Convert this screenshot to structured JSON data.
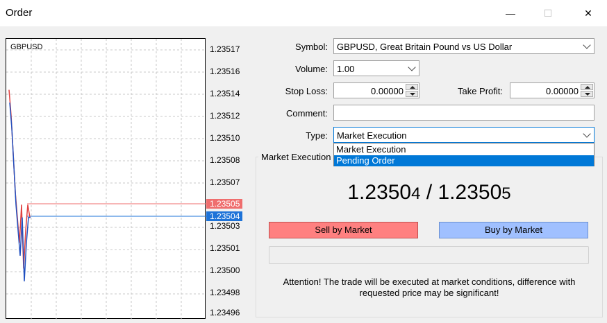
{
  "window": {
    "title": "Order",
    "minimize_glyph": "—",
    "maximize_glyph": "☐",
    "close_glyph": "✕"
  },
  "chart": {
    "symbol": "GBPUSD",
    "ask_price": "1.23505",
    "bid_price": "1.23504",
    "ask_color": "#ef6e6e",
    "bid_color": "#1e73d8",
    "ticks": [
      "1.23517",
      "1.23516",
      "1.23514",
      "1.23512",
      "1.23510",
      "1.23508",
      "1.23507",
      "1.23503",
      "1.23501",
      "1.23500",
      "1.23498",
      "1.23496"
    ]
  },
  "chart_data": {
    "type": "line",
    "title": "GBPUSD",
    "xlabel": "",
    "ylabel": "",
    "ylim": [
      1.23496,
      1.23518
    ],
    "grid": true,
    "series": [
      {
        "values": [
          1.23514,
          1.23512,
          1.23509,
          1.23506,
          1.23504,
          1.23502,
          1.23505,
          1.235,
          1.23503,
          1.23505,
          1.23504
        ]
      },
      {
        "values": [
          1.23513,
          1.23511,
          1.23508,
          1.23505,
          1.23503,
          1.23501,
          1.23504,
          1.23499,
          1.23502,
          1.23504,
          1.23504
        ]
      }
    ]
  },
  "form": {
    "symbol_label": "Symbol:",
    "symbol_value": "GBPUSD, Great Britain Pound vs US Dollar",
    "volume_label": "Volume:",
    "volume_value": "1.00",
    "stoploss_label": "Stop Loss:",
    "stoploss_value": "0.00000",
    "takeprofit_label": "Take Profit:",
    "takeprofit_value": "0.00000",
    "comment_label": "Comment:",
    "comment_value": "",
    "type_label": "Type:",
    "type_value": "Market Execution",
    "type_options": [
      "Market Execution",
      "Pending Order"
    ]
  },
  "execution": {
    "group_title": "Market Execution",
    "bid_main": "1.2350",
    "bid_small": "4",
    "separator": " / ",
    "ask_main": "1.2350",
    "ask_small": "5",
    "sell_label": "Sell by Market",
    "buy_label": "Buy by Market",
    "attention": "Attention! The trade will be executed at market conditions, difference with requested price may be significant!"
  }
}
